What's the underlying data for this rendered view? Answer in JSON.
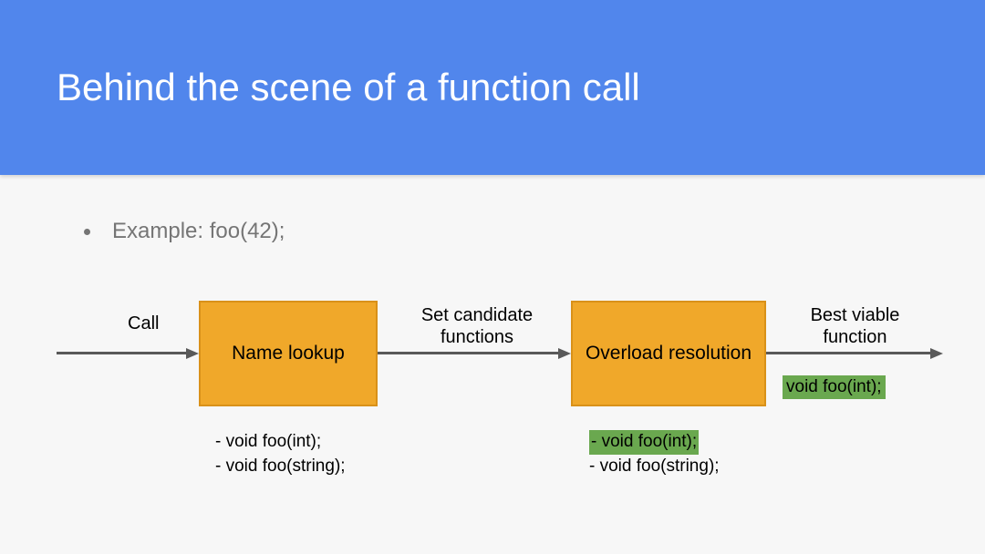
{
  "header": {
    "title": "Behind the scene of a function call"
  },
  "bullet": {
    "text": "Example: foo(42);"
  },
  "diagram": {
    "call_label": "Call",
    "box1": "Name lookup",
    "set_candidate_label": "Set candidate functions",
    "box2": "Overload resolution",
    "best_viable_label": "Best viable function",
    "list1_item1": "- void foo(int);",
    "list1_item2": "- void foo(string);",
    "list2_item1": "- void foo(int);",
    "list2_item2": "- void foo(string);",
    "result": "void foo(int);"
  }
}
